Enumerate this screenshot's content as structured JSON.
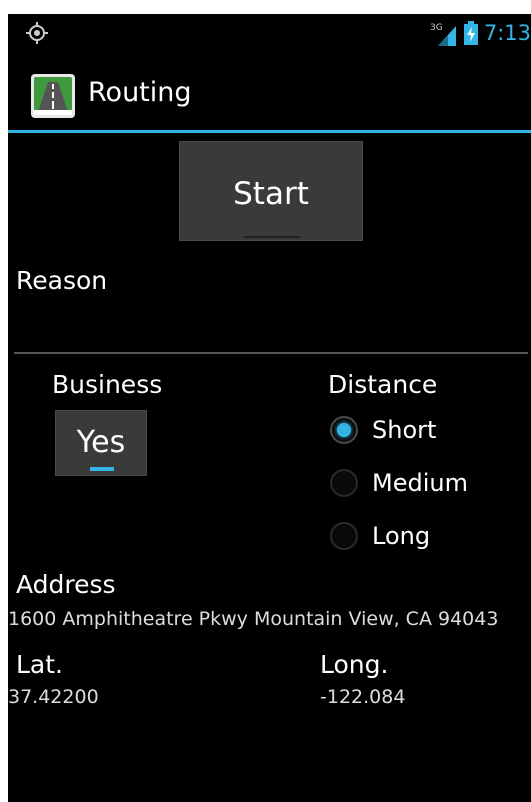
{
  "status_bar": {
    "network_type": "3G",
    "time": "7:13",
    "left_icon": "location-icon",
    "signal_icon": "signal-icon",
    "battery_icon": "battery-charging-icon"
  },
  "action_bar": {
    "title": "Routing",
    "app_icon": "highway-icon"
  },
  "form": {
    "start_button": "Start",
    "reason_label": "Reason",
    "reason_value": "",
    "business_label": "Business",
    "business_toggle": "Yes",
    "distance_label": "Distance",
    "distance_options": [
      {
        "label": "Short",
        "checked": true
      },
      {
        "label": "Medium",
        "checked": false
      },
      {
        "label": "Long",
        "checked": false
      }
    ],
    "address_label": "Address",
    "address_value": "1600 Amphitheatre Pkwy Mountain View, CA 94043",
    "lat_label": "Lat.",
    "lat_value": "37.42200",
    "long_label": "Long.",
    "long_value": "-122.084"
  },
  "colors": {
    "accent": "#33b5e5",
    "background": "#000000",
    "button": "#3a3a3a"
  }
}
